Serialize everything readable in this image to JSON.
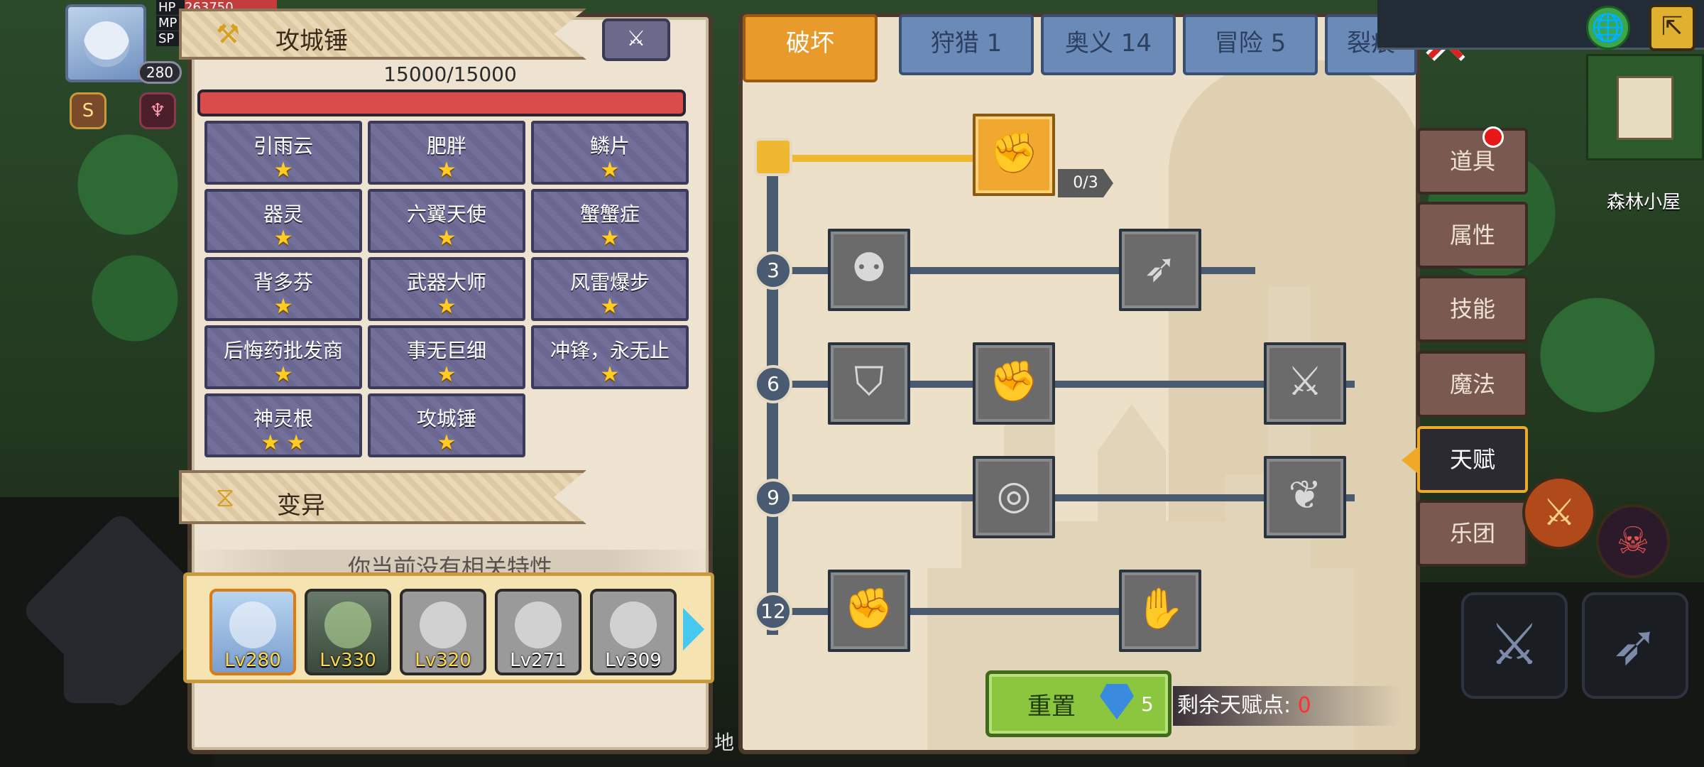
{
  "hud": {
    "hp_label": "HP",
    "hp_value": "263750",
    "mp_label": "MP",
    "sp_label": "SP",
    "level": "280"
  },
  "left_panel": {
    "section_title": "攻城锤",
    "hp": "15000/15000",
    "hp_fill": 1.0,
    "traits": [
      {
        "name": "引雨云",
        "stars": "★"
      },
      {
        "name": "肥胖",
        "stars": "★"
      },
      {
        "name": "鳞片",
        "stars": "★"
      },
      {
        "name": "器灵",
        "stars": "★"
      },
      {
        "name": "六翼天使",
        "stars": "★"
      },
      {
        "name": "蟹蟹症",
        "stars": "★"
      },
      {
        "name": "背多芬",
        "stars": "★"
      },
      {
        "name": "武器大师",
        "stars": "★"
      },
      {
        "name": "风雷爆步",
        "stars": "★"
      },
      {
        "name": "后悔药批发商",
        "stars": "★"
      },
      {
        "name": "事无巨细",
        "stars": "★"
      },
      {
        "name": "冲锋，永无止",
        "stars": "★"
      },
      {
        "name": "神灵根",
        "stars": "★ ★"
      },
      {
        "name": "攻城锤",
        "stars": "★"
      }
    ],
    "mutation_label": "变异",
    "no_trait_text": "你当前没有相关特性",
    "heroes": [
      {
        "level": "Lv280",
        "selected": true
      },
      {
        "level": "Lv330",
        "selected": false
      },
      {
        "level": "Lv320",
        "selected": false
      },
      {
        "level": "Lv271",
        "selected": false
      },
      {
        "level": "Lv309",
        "selected": false
      }
    ]
  },
  "tabs": [
    {
      "label": "破坏",
      "active": true
    },
    {
      "label": "狩猎 1",
      "active": false
    },
    {
      "label": "奥义 14",
      "active": false
    },
    {
      "label": "冒险 5",
      "active": false
    },
    {
      "label": "裂痕",
      "active": false
    }
  ],
  "talent_tree": {
    "first_talent_progress": "0/3",
    "row_levels": [
      "3",
      "6",
      "9",
      "12"
    ]
  },
  "footer": {
    "reset_label": "重置",
    "reset_cost": "5",
    "remaining_label": "剩余天赋点:",
    "remaining_value": "0"
  },
  "side_menu": [
    "道具",
    "属性",
    "技能",
    "魔法",
    "天赋",
    "乐团"
  ],
  "side_menu_active": "天赋",
  "world": {
    "place_name": "森林小屋",
    "map_label": "地"
  },
  "colors": {
    "accent_orange": "#e89a2a",
    "tab_blue": "#6a8ab8",
    "reset_green": "#8cc63f",
    "hp_red": "#d94c4c",
    "remain_red": "#ff3030"
  }
}
